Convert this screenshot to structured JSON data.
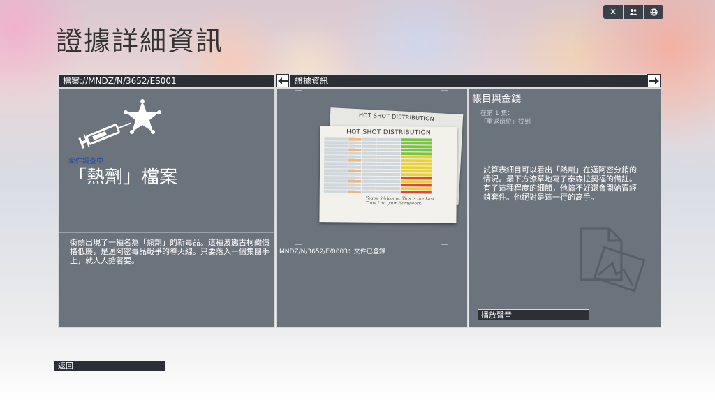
{
  "page": {
    "title": "證據詳細資訊"
  },
  "top_icons": [
    {
      "name": "close-icon",
      "glyph": "✕"
    },
    {
      "name": "friends-icon",
      "glyph": "👥"
    },
    {
      "name": "globe-icon",
      "glyph": "🌐"
    }
  ],
  "case_panel": {
    "header": "檔案://MNDZ/N/3652/ES001",
    "status": "案件調查中",
    "title": "「熱劑」檔案",
    "description": "街頭出現了一種名為「熱劑」的新毒品。這種波態古柯鹼價格低廉，是邁阿密毒品戰爭的導火線。只要落入一個集團手上，就人人搶著要。",
    "icons": [
      "syringe-icon",
      "police-badge-icon"
    ]
  },
  "evidence_panel": {
    "header": "證據資訊",
    "document_heading": "HOT SHOT DISTRIBUTION",
    "handwriting": "You're Welcome. This is the Last Time I do your Homework!",
    "caption": "MNDZ/N/3652/E/0003：文件已登錄",
    "prev_icon": "arrow-left-icon",
    "next_icon": "arrow-right-icon"
  },
  "detail_panel": {
    "title": "帳目與金錢",
    "meta_line1": "在第 1 集：",
    "meta_line2": "「重返崗位」找到",
    "body": "試算表細目可以看出「熱劑」在邁阿密分銷的情況。最下方潦草地寫了泰森拉契福的備註。有了這種程度的細節，他搞不好還會開始賣經銷套件。他絕對是這一行的高手。",
    "play_audio_label": "播放聲音",
    "watermark_icon": "document-image-icon"
  },
  "footer": {
    "back_label": "返回"
  },
  "colors": {
    "panel_bg": "#6b737c",
    "bar_bg": "#2c3036",
    "status_blue": "#1f4fa8",
    "sheet_green": "#7cc34a",
    "sheet_yellow": "#e8d23a",
    "sheet_red": "#e0473c"
  }
}
